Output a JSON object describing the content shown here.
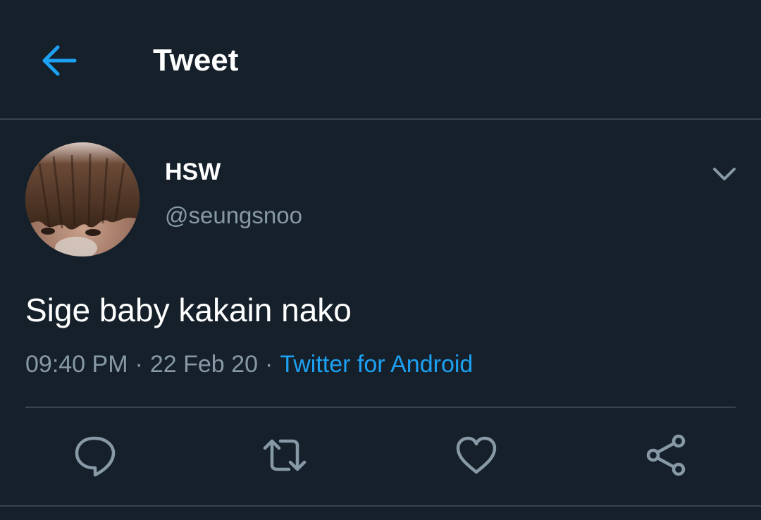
{
  "header": {
    "title": "Tweet",
    "back_icon": "arrow-left-icon"
  },
  "author": {
    "display_name": "HSW",
    "handle": "@seungsnoo",
    "more_icon": "chevron-down-icon"
  },
  "tweet": {
    "text": "Sige baby kakain nako",
    "time": "09:40 PM",
    "separator": "·",
    "date": "22 Feb 20",
    "source": "Twitter for Android"
  },
  "actions": [
    {
      "name": "reply",
      "icon": "reply-icon"
    },
    {
      "name": "retweet",
      "icon": "retweet-icon"
    },
    {
      "name": "like",
      "icon": "heart-icon"
    },
    {
      "name": "share",
      "icon": "share-icon"
    }
  ],
  "colors": {
    "background": "#15202b",
    "accent": "#1da1f2",
    "secondary_text": "#8899a6",
    "divider": "#38444d",
    "icon": "#8899a6"
  }
}
